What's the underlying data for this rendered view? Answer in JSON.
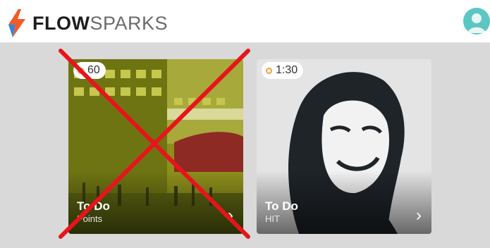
{
  "brand": {
    "bold": "FLOW",
    "light": "SPARKS"
  },
  "colors": {
    "accent_orange": "#f2a23a",
    "avatar": "#5bc6c2",
    "cross_red": "#e8141b",
    "card1_tint": "#a2a516"
  },
  "cards": [
    {
      "duration": "60",
      "title": "To Do",
      "subtitle": "Points",
      "crossed_out": true,
      "icon": "clock-icon"
    },
    {
      "duration": "1:30",
      "title": "To Do",
      "subtitle": "HIT",
      "crossed_out": false,
      "icon": "clock-icon"
    }
  ]
}
